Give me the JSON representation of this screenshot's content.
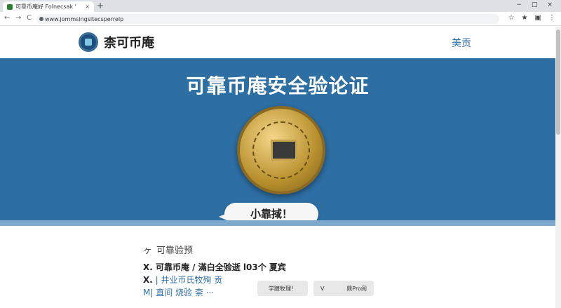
{
  "browser": {
    "tab_title": "可靠币庵好 Folnecsak '",
    "tab_close": "×",
    "new_tab": "+",
    "window_controls": [
      "−",
      "□",
      "×"
    ],
    "url": "www.jommsingsitecsperrelp",
    "nav_back": "←",
    "nav_forward": "→",
    "nav_reload": "C",
    "right_icons": [
      "☆",
      "★",
      "▣",
      "⋮"
    ]
  },
  "header": {
    "logo_text": "柰可币庵",
    "nav_link": "美贡"
  },
  "hero": {
    "title": "可靠币庵安全验论证",
    "bubble_text": "小靠掝！",
    "bg_color": "#2d6ea3"
  },
  "content": {
    "section_title_icon": "ヶ",
    "section_title": "可靠验预",
    "line1": "X. 可靠币庵 / 滿白全验逝 l03个 夏宾",
    "line2_prefix": "X.",
    "line2_text": "| 井业币氏牧殉 贡",
    "line3": "M| 直间 烧验  柰 ···",
    "button1": "学踱牧理！",
    "button2_icon": "V",
    "button2_text": "鼎Pro阅"
  }
}
